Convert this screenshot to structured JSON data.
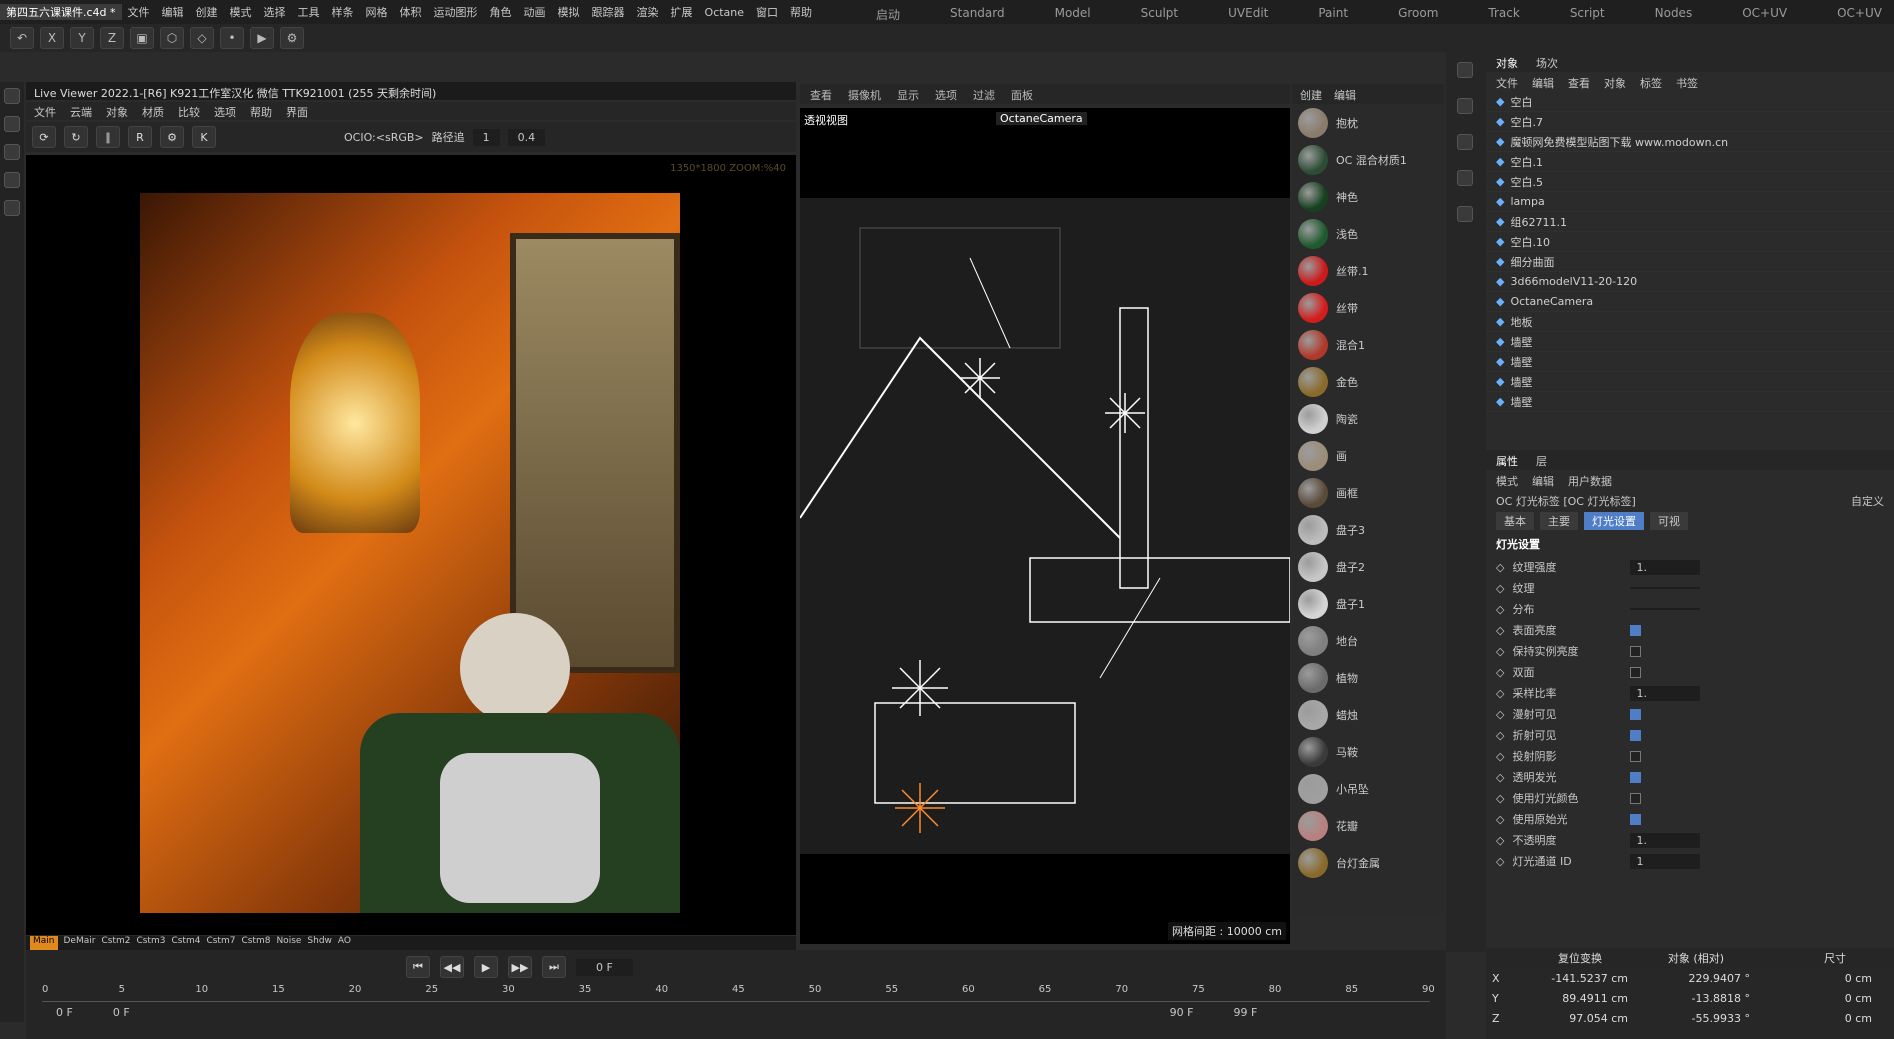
{
  "menubar": {
    "file_label": "第四五六课课件.c4d *",
    "items": [
      "文件",
      "编辑",
      "创建",
      "模式",
      "选择",
      "工具",
      "样条",
      "网格",
      "体积",
      "运动图形",
      "角色",
      "动画",
      "模拟",
      "跟踪器",
      "渲染",
      "扩展",
      "Octane",
      "窗口",
      "帮助"
    ],
    "layouts": [
      "启动",
      "Standard",
      "Model",
      "Sculpt",
      "UVEdit",
      "Paint",
      "Groom",
      "Track",
      "Script",
      "Nodes",
      "OC+UV",
      "OC+UV"
    ]
  },
  "live_viewer": {
    "title": "Live Viewer 2022.1-[R6]  K921工作室汉化  微信  TTK921001 (255 天剩余时间)",
    "menu": [
      "文件",
      "云端",
      "对象",
      "材质",
      "比较",
      "选项",
      "帮助",
      "界面"
    ],
    "ocio": "OCIO:<sRGB>",
    "mode": "路径追",
    "val1": "1",
    "val2": "0.4",
    "res": "1350*1800 ZOOM:%40",
    "statusbar": [
      "Main",
      "DeMair",
      "Cstm2",
      "Cstm3",
      "Cstm4",
      "Cstm7",
      "Cstm8",
      "Noise",
      "Shdw",
      "AO"
    ]
  },
  "viewport": {
    "menu": [
      "查看",
      "摄像机",
      "显示",
      "选项",
      "过滤",
      "面板"
    ],
    "label": "透视视图",
    "camera": "OctaneCamera",
    "grid": "网格间距 : 10000 cm"
  },
  "materials": {
    "menu": [
      "创建",
      "编辑"
    ],
    "items": [
      {
        "name": "抱枕",
        "color": "#8a7b6a"
      },
      {
        "name": "OC 混合材质1",
        "color": "#2c4c34"
      },
      {
        "name": "神色",
        "color": "#16401f"
      },
      {
        "name": "浅色",
        "color": "#1f5a2e"
      },
      {
        "name": "丝带.1",
        "color": "#cc1a1a"
      },
      {
        "name": "丝带",
        "color": "#d41c1c"
      },
      {
        "name": "混合1",
        "color": "#b0382a"
      },
      {
        "name": "金色",
        "color": "#8a6a2a"
      },
      {
        "name": "陶瓷",
        "color": "#d0d0d0"
      },
      {
        "name": "画",
        "color": "#9b8d78"
      },
      {
        "name": "画框",
        "color": "#5a4a3a"
      },
      {
        "name": "盘子3",
        "color": "#bdbdbd"
      },
      {
        "name": "盘子2",
        "color": "#c7c7c7"
      },
      {
        "name": "盘子1",
        "color": "#d5d5d5"
      },
      {
        "name": "地台",
        "color": "#7f7f7f"
      },
      {
        "name": "植物",
        "color": "#6b6b6b"
      },
      {
        "name": "蜡烛",
        "color": "#a8a8a8"
      },
      {
        "name": "马鞍",
        "color": "#3a3a3a"
      },
      {
        "name": "小吊坠",
        "color": "#9f9f9f"
      },
      {
        "name": "花瓣",
        "color": "#b98080"
      },
      {
        "name": "台灯金属",
        "color": "#8a6a2a"
      }
    ]
  },
  "objects": {
    "tabs": [
      "对象",
      "场次"
    ],
    "menu": [
      "文件",
      "编辑",
      "查看",
      "对象",
      "标签",
      "书签"
    ],
    "rows": [
      "空白",
      "空白.7",
      "魔顿网免费模型贴图下载 www.modown.cn",
      "空白.1",
      "空白.5",
      "lampa",
      "组62711.1",
      "空白.10",
      "细分曲面",
      "3d66modelV11-20-120",
      "OctaneCamera",
      "地板",
      "墙壁",
      "墙壁",
      "墙壁",
      "墙壁"
    ]
  },
  "attributes": {
    "tabs": [
      "属性",
      "层"
    ],
    "menu": [
      "模式",
      "编辑",
      "用户数据"
    ],
    "title": "OC 灯光标签 [OC 灯光标签]",
    "custom": "自定义",
    "subtabs": [
      "基本",
      "主要",
      "灯光设置",
      "可视"
    ],
    "section": "灯光设置",
    "rows": [
      {
        "label": "纹理强度",
        "value": "1."
      },
      {
        "label": "纹理",
        "value": ""
      },
      {
        "label": "分布",
        "value": ""
      },
      {
        "label": "表面亮度",
        "check": true
      },
      {
        "label": "保持实例亮度",
        "check": false
      },
      {
        "label": "双面",
        "check": false
      },
      {
        "label": "采样比率",
        "value": "1."
      },
      {
        "label": "漫射可见",
        "check": true
      },
      {
        "label": "折射可见",
        "check": true
      },
      {
        "label": "投射阴影",
        "check": false
      },
      {
        "label": "透明发光",
        "check": true
      },
      {
        "label": "使用灯光颜色",
        "check": false
      },
      {
        "label": "使用原始光",
        "check": true
      },
      {
        "label": "不透明度",
        "value": "1."
      },
      {
        "label": "灯光通道 ID",
        "value": "1"
      }
    ]
  },
  "timeline": {
    "frame": "0 F",
    "ticks": [
      "0",
      "5",
      "10",
      "15",
      "20",
      "25",
      "30",
      "35",
      "40",
      "45",
      "50",
      "55",
      "60",
      "65",
      "70",
      "75",
      "80",
      "85",
      "90"
    ],
    "start": "0 F",
    "start2": "0 F",
    "end": "90 F",
    "end2": "99 F"
  },
  "coords": {
    "header": [
      "复位变换",
      "对象 (相对)",
      "尺寸"
    ],
    "rows": [
      {
        "axis": "X",
        "pos": "-141.5237 cm",
        "rot": "229.9407 °",
        "size": "0 cm"
      },
      {
        "axis": "Y",
        "pos": "89.4911 cm",
        "rot": "-13.8818 °",
        "size": "0 cm"
      },
      {
        "axis": "Z",
        "pos": "97.054 cm",
        "rot": "-55.9933 °",
        "size": "0 cm"
      }
    ]
  }
}
